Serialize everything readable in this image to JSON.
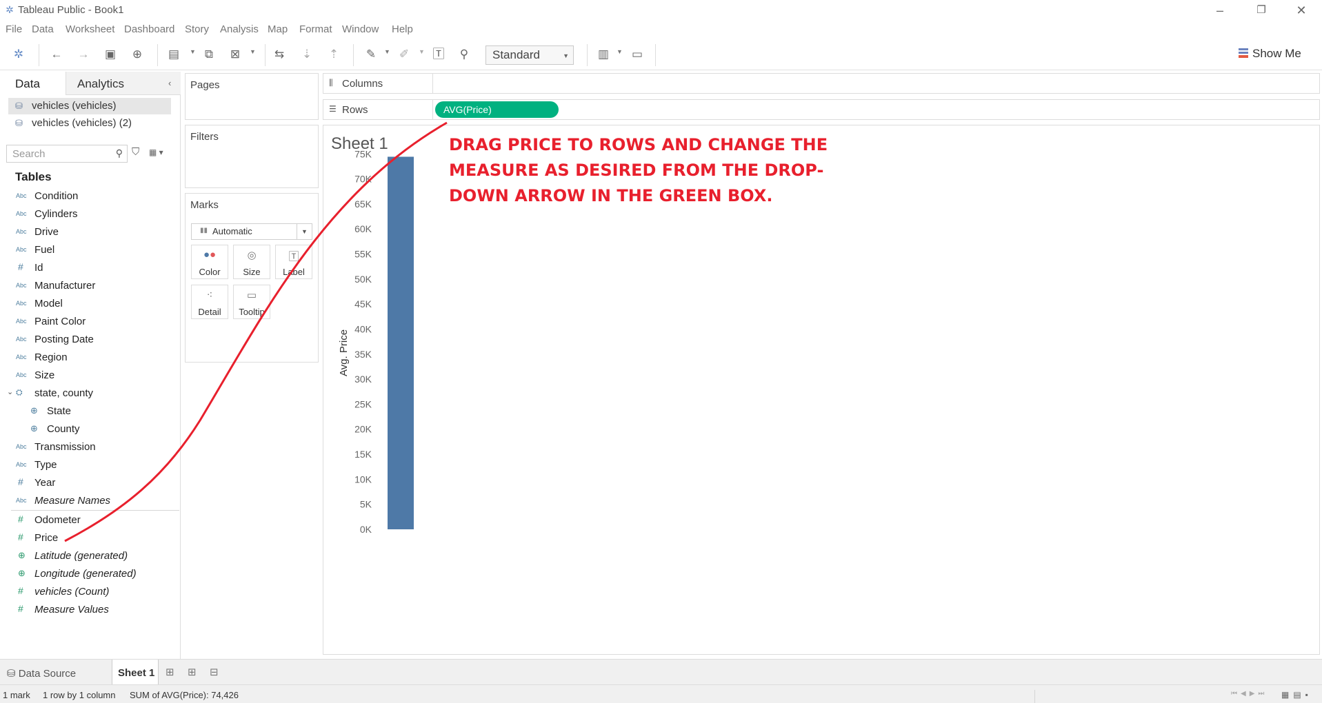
{
  "window": {
    "title": "Tableau Public - Book1"
  },
  "menu": [
    "File",
    "Data",
    "Worksheet",
    "Dashboard",
    "Story",
    "Analysis",
    "Map",
    "Format",
    "Window",
    "Help"
  ],
  "toolbar": {
    "fit_mode": "Standard",
    "show_me_label": "Show Me"
  },
  "data_pane": {
    "tabs": {
      "data": "Data",
      "analytics": "Analytics"
    },
    "datasources": [
      "vehicles (vehicles)",
      "vehicles (vehicles) (2)"
    ],
    "search_placeholder": "Search",
    "tables_heading": "Tables",
    "type_abc": "Abc",
    "type_measure": "#",
    "fields": {
      "condition": "Condition",
      "cylinders": "Cylinders",
      "drive": "Drive",
      "fuel": "Fuel",
      "id": "Id",
      "manufacturer": "Manufacturer",
      "model": "Model",
      "paint_color": "Paint Color",
      "posting_date": "Posting Date",
      "region": "Region",
      "size": "Size",
      "state_county": "state, county",
      "state": "State",
      "county": "County",
      "transmission": "Transmission",
      "type": "Type",
      "year": "Year",
      "measure_names": "Measure Names",
      "odometer": "Odometer",
      "price": "Price",
      "latitude": "Latitude (generated)",
      "longitude": "Longitude (generated)",
      "vehicles_count": "vehicles (Count)",
      "measure_values": "Measure Values"
    }
  },
  "cards": {
    "pages": "Pages",
    "filters": "Filters",
    "marks": "Marks",
    "mark_type": "Automatic",
    "mark_buttons": {
      "color": "Color",
      "size": "Size",
      "label": "Label",
      "detail": "Detail",
      "tooltip": "Tooltip"
    }
  },
  "shelves": {
    "columns": "Columns",
    "rows": "Rows",
    "rows_pill": "AVG(Price)"
  },
  "view": {
    "sheet_title": "Sheet 1",
    "annotation": "DRAG PRICE TO ROWS AND CHANGE THE MEASURE AS DESIRED FROM THE DROP-DOWN ARROW IN THE GREEN BOX.",
    "annotation_color": "#e8202d"
  },
  "chart_data": {
    "type": "bar",
    "categories": [
      ""
    ],
    "values": [
      74426
    ],
    "ylabel": "Avg. Price",
    "ylim": [
      0,
      76000
    ],
    "yticks": [
      0,
      5000,
      10000,
      15000,
      20000,
      25000,
      30000,
      35000,
      40000,
      45000,
      50000,
      55000,
      60000,
      65000,
      70000,
      75000
    ],
    "ytick_labels": [
      "0K",
      "5K",
      "10K",
      "15K",
      "20K",
      "25K",
      "30K",
      "35K",
      "40K",
      "45K",
      "50K",
      "55K",
      "60K",
      "65K",
      "70K",
      "75K"
    ],
    "bar_color": "#4e79a7"
  },
  "sheet_tabs": {
    "data_source": "Data Source",
    "sheet1": "Sheet 1"
  },
  "status": {
    "marks": "1 mark",
    "dims": "1 row by 1 column",
    "sum": "SUM of AVG(Price): 74,426"
  },
  "colors": {
    "pill": "#00b180",
    "accent": "#e8202d"
  }
}
